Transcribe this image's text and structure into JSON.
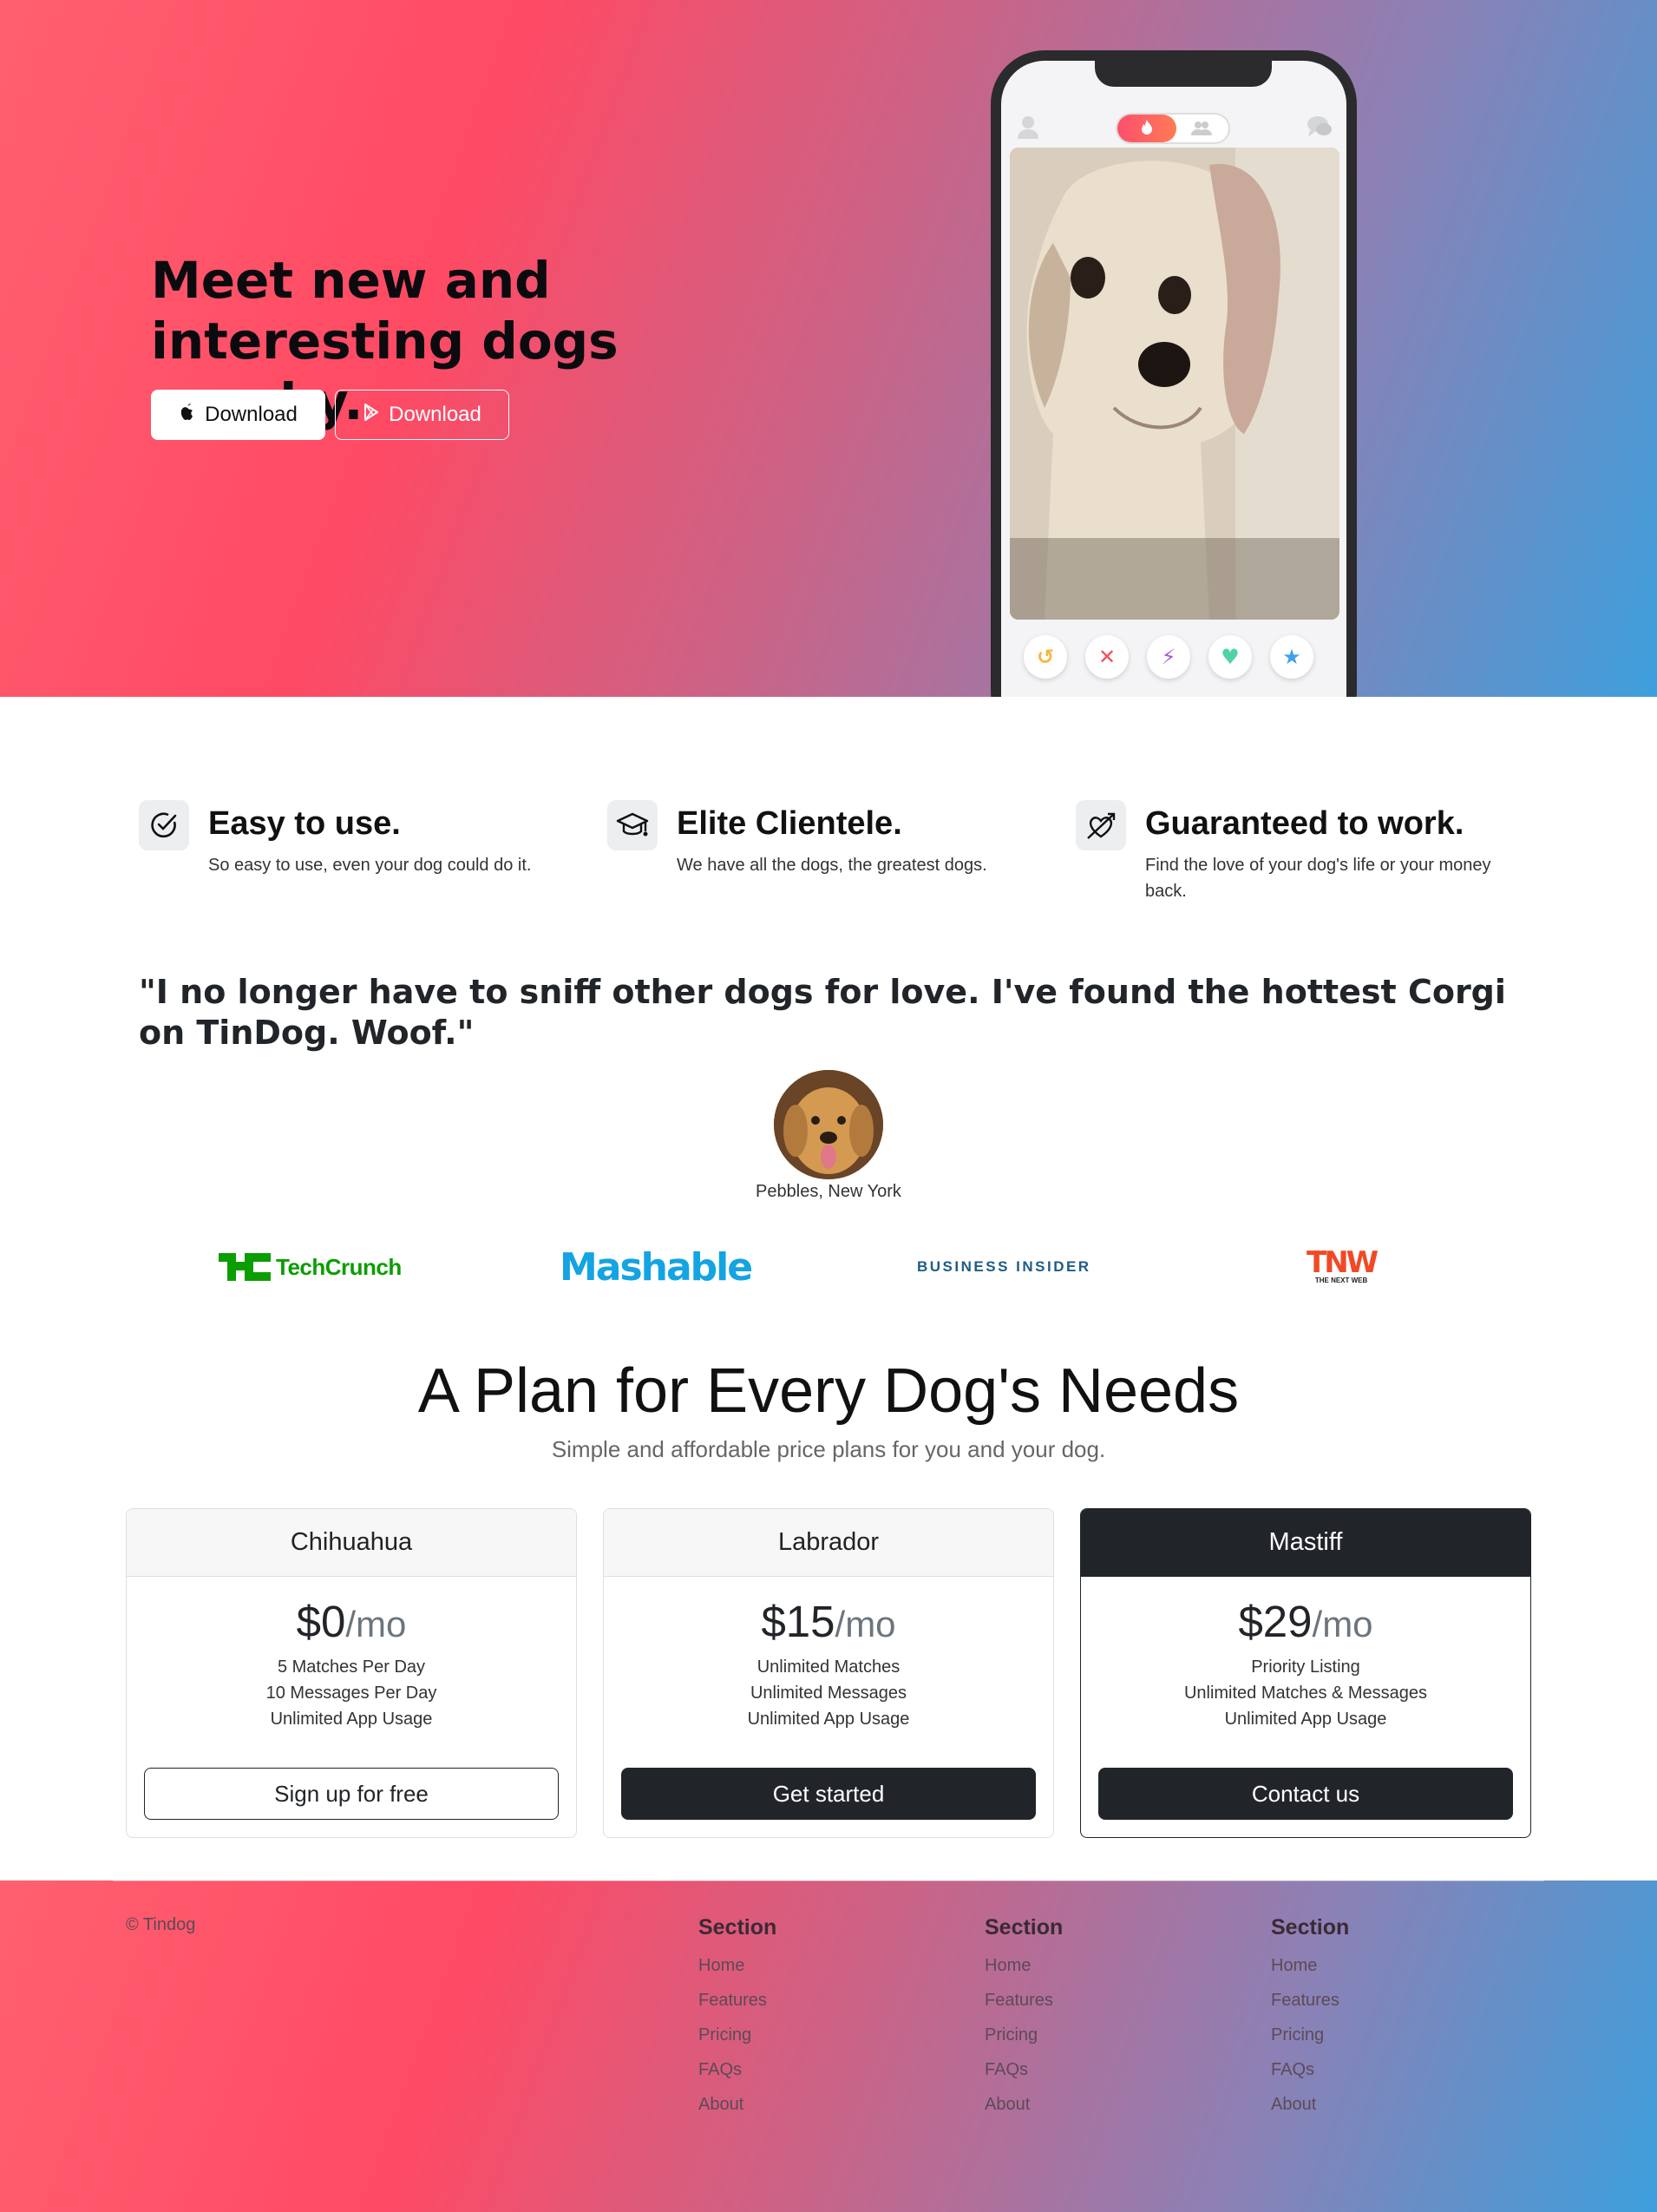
{
  "hero": {
    "title": "Meet new and interesting dogs nearby.",
    "download_apple_label": "Download",
    "download_play_label": "Download"
  },
  "features": [
    {
      "title": "Easy to use.",
      "text": "So easy to use, even your dog could do it.",
      "icon": "check-circle-icon"
    },
    {
      "title": "Elite Clientele.",
      "text": "We have all the dogs, the greatest dogs.",
      "icon": "graduation-cap-icon"
    },
    {
      "title": "Guaranteed to work.",
      "text": "Find the love of your dog's life or your money back.",
      "icon": "heart-arrow-icon"
    }
  ],
  "testimonial": {
    "quote": "\"I no longer have to sniff other dogs for love. I've found the hottest Corgi on TinDog. Woof.\"",
    "author": "Pebbles, New York"
  },
  "press": {
    "techcrunch": "TechCrunch",
    "mashable": "Mashable",
    "business_insider": "BUSINESS INSIDER",
    "tnw": "TNW",
    "tnw_sub": "THE NEXT WEB"
  },
  "pricing": {
    "title": "A Plan for Every Dog's Needs",
    "subtitle": "Simple and affordable price plans for you and your dog.",
    "plans": [
      {
        "name": "Chihuahua",
        "price": "$0",
        "period": "/mo",
        "features": [
          "5 Matches Per Day",
          "10 Messages Per Day",
          "Unlimited App Usage"
        ],
        "button": "Sign up for free"
      },
      {
        "name": "Labrador",
        "price": "$15",
        "period": "/mo",
        "features": [
          "Unlimited Matches",
          "Unlimited Messages",
          "Unlimited App Usage"
        ],
        "button": "Get started"
      },
      {
        "name": "Mastiff",
        "price": "$29",
        "period": "/mo",
        "features": [
          "Priority Listing",
          "Unlimited Matches & Messages",
          "Unlimited App Usage"
        ],
        "button": "Contact us"
      }
    ]
  },
  "footer": {
    "copyright": "© Tindog",
    "columns": [
      {
        "heading": "Section",
        "links": [
          "Home",
          "Features",
          "Pricing",
          "FAQs",
          "About"
        ]
      },
      {
        "heading": "Section",
        "links": [
          "Home",
          "Features",
          "Pricing",
          "FAQs",
          "About"
        ]
      },
      {
        "heading": "Section",
        "links": [
          "Home",
          "Features",
          "Pricing",
          "FAQs",
          "About"
        ]
      }
    ]
  },
  "colors": {
    "gradient_start": "#ff4a64",
    "gradient_end": "#3d9fdc",
    "dark": "#212529"
  }
}
